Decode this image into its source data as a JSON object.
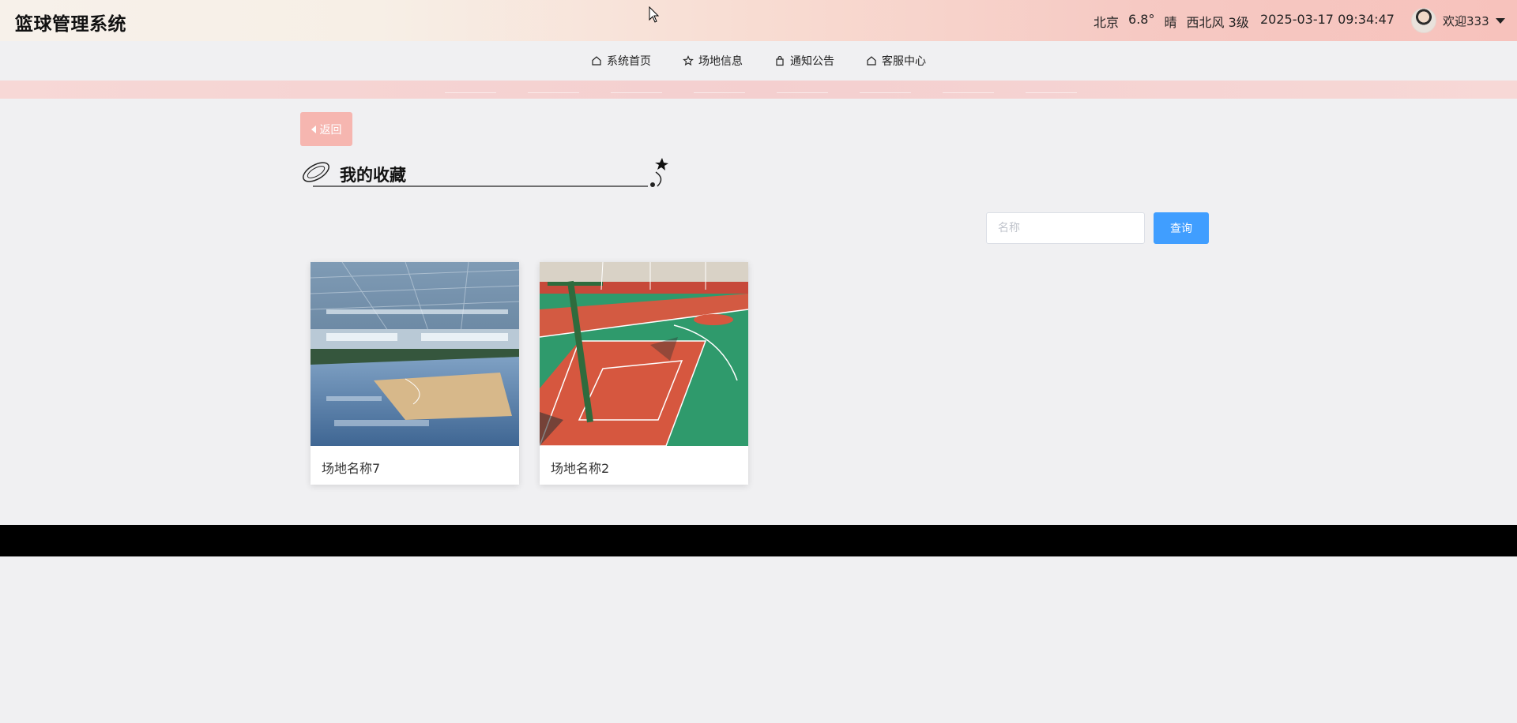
{
  "header": {
    "brand": "篮球管理系统",
    "weather": {
      "city": "北京",
      "temp": "6.8°",
      "condition": "晴",
      "wind_dir": "西北风",
      "wind_level": "3级"
    },
    "datetime": "2025-03-17 09:34:47",
    "user": {
      "greeting": "欢迎333"
    }
  },
  "nav": {
    "items": [
      {
        "label": "系统首页",
        "icon": "home-icon"
      },
      {
        "label": "场地信息",
        "icon": "star-icon"
      },
      {
        "label": "通知公告",
        "icon": "bag-icon"
      },
      {
        "label": "客服中心",
        "icon": "home-icon"
      }
    ]
  },
  "page": {
    "back_label": "返回",
    "title": "我的收藏",
    "search": {
      "placeholder": "名称",
      "value": "",
      "button_label": "查询"
    }
  },
  "favorites": [
    {
      "name": "场地名称7"
    },
    {
      "name": "场地名称2"
    }
  ],
  "colors": {
    "accent": "#409eff",
    "back_button": "#f6b6b0",
    "footer": "#000000",
    "background": "#f0f0f2"
  }
}
